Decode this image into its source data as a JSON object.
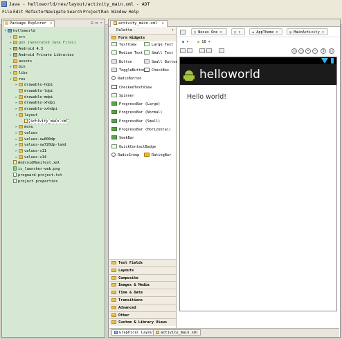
{
  "window": {
    "title": "Java - helloworld/res/layout/activity_main.xml - ADT"
  },
  "menu": [
    "File",
    "Edit",
    "Refactor",
    "Navigate",
    "Search",
    "Project",
    "Run",
    "Window",
    "Help"
  ],
  "package_explorer": {
    "tab_label": "Package Explorer",
    "close_glyph": "✕",
    "tree": [
      {
        "label": "helloworld",
        "icon": "project-icon",
        "twisty": "▾",
        "indent": 0
      },
      {
        "label": "src",
        "icon": "folder-icon",
        "twisty": "▸",
        "indent": 1
      },
      {
        "label": "gen [Generated Java Files]",
        "icon": "folder-icon",
        "twisty": "▸",
        "indent": 1
      },
      {
        "label": "Android 4.3",
        "icon": "library-icon",
        "twisty": "▸",
        "indent": 1
      },
      {
        "label": "Android Private Libraries",
        "icon": "library-icon",
        "twisty": "▸",
        "indent": 1
      },
      {
        "label": "assets",
        "icon": "folder-icon",
        "twisty": "",
        "indent": 1
      },
      {
        "label": "bin",
        "icon": "folder-icon",
        "twisty": "▸",
        "indent": 1
      },
      {
        "label": "libs",
        "icon": "folder-icon",
        "twisty": "▸",
        "indent": 1
      },
      {
        "label": "res",
        "icon": "folder-icon",
        "twisty": "▾",
        "indent": 1
      },
      {
        "label": "drawable-hdpi",
        "icon": "folder-icon",
        "twisty": "▸",
        "indent": 2
      },
      {
        "label": "drawable-ldpi",
        "icon": "folder-icon",
        "twisty": "",
        "indent": 2
      },
      {
        "label": "drawable-mdpi",
        "icon": "folder-icon",
        "twisty": "▸",
        "indent": 2
      },
      {
        "label": "drawable-xhdpi",
        "icon": "folder-icon",
        "twisty": "▸",
        "indent": 2
      },
      {
        "label": "drawable-xxhdpi",
        "icon": "folder-icon",
        "twisty": "▸",
        "indent": 2
      },
      {
        "label": "layout",
        "icon": "folder-icon",
        "twisty": "▾",
        "indent": 2
      },
      {
        "label": "activity_main.xml",
        "icon": "xml-file-icon",
        "twisty": "",
        "indent": 3,
        "selected": true
      },
      {
        "label": "menu",
        "icon": "folder-icon",
        "twisty": "▸",
        "indent": 2
      },
      {
        "label": "values",
        "icon": "folder-icon",
        "twisty": "▸",
        "indent": 2
      },
      {
        "label": "values-sw600dp",
        "icon": "folder-icon",
        "twisty": "▸",
        "indent": 2
      },
      {
        "label": "values-sw720dp-land",
        "icon": "folder-icon",
        "twisty": "▸",
        "indent": 2
      },
      {
        "label": "values-v11",
        "icon": "folder-icon",
        "twisty": "▸",
        "indent": 2
      },
      {
        "label": "values-v14",
        "icon": "folder-icon",
        "twisty": "▸",
        "indent": 2
      },
      {
        "label": "AndroidManifest.xml",
        "icon": "xml-file-icon",
        "twisty": "",
        "indent": 1
      },
      {
        "label": "ic_launcher-web.png",
        "icon": "image-file-icon",
        "twisty": "",
        "indent": 1
      },
      {
        "label": "proguard-project.txt",
        "icon": "text-file-icon",
        "twisty": "",
        "indent": 1
      },
      {
        "label": "project.properties",
        "icon": "text-file-icon",
        "twisty": "",
        "indent": 1
      }
    ]
  },
  "editor": {
    "tab_label": "activity_main.xml",
    "palette": {
      "title": "Palette",
      "open_category": "Form Widgets",
      "items": [
        [
          "TextView",
          "Large Text"
        ],
        [
          "Medium Text",
          "Small Text"
        ],
        [
          "Button",
          "Small Button"
        ],
        [
          "ToggleButton",
          "CheckBox"
        ],
        [
          "RadioButton"
        ],
        [
          "CheckedTextView"
        ],
        [
          "Spinner"
        ],
        [
          "ProgressBar (Large)"
        ],
        [
          "ProgressBar (Normal)"
        ],
        [
          "ProgressBar (Small)"
        ],
        [
          "ProgressBar (Horizontal)"
        ],
        [
          "SeekBar"
        ],
        [
          "QuickContactBadge"
        ],
        [
          "RadioGroup",
          "RatingBar"
        ]
      ],
      "categories": [
        "Text Fields",
        "Layouts",
        "Composite",
        "Images & Media",
        "Time & Date",
        "Transitions",
        "Advanced",
        "Other",
        "Custom & Library Views"
      ]
    },
    "canvas": {
      "device": "Nexus One",
      "theme": "AppTheme",
      "activity": "MainActivity",
      "api_level": "18",
      "app_title": "helloworld",
      "content_text": "Hello world!"
    },
    "bottom_tabs": [
      "Graphical Layout",
      "activity_main.xml"
    ]
  },
  "colors": {
    "explorer_background": "#d5e9d2",
    "action_bar": "#1b1b1b",
    "android_green": "#a4c639",
    "status_icons": "#33b5e5"
  }
}
